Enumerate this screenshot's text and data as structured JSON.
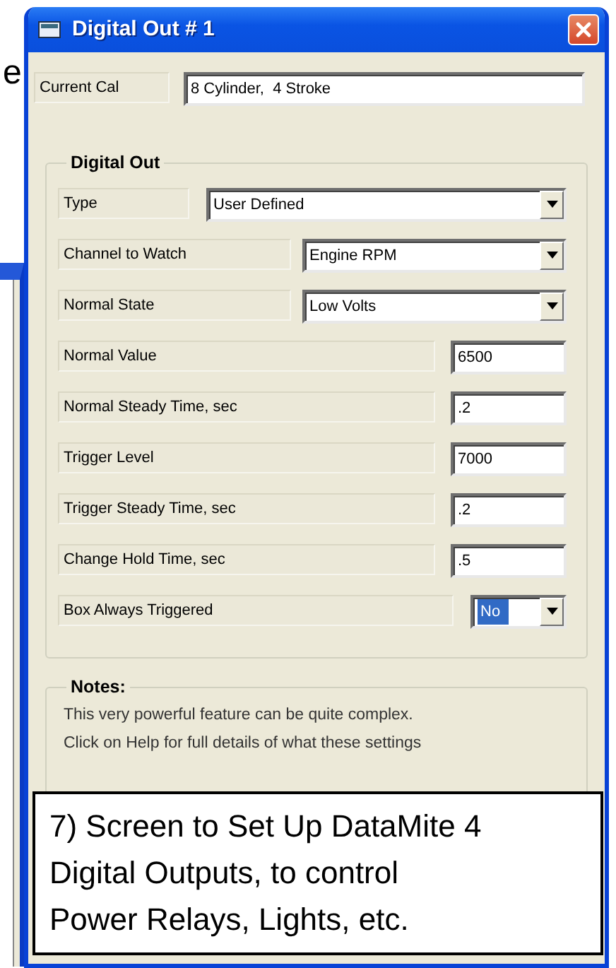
{
  "background_text": "e",
  "window": {
    "title": "Digital Out # 1"
  },
  "current_cal": {
    "label": "Current Cal",
    "value": "8 Cylinder,  4 Stroke"
  },
  "digital_out": {
    "title": "Digital Out",
    "fields": [
      {
        "kind": "combo-wide",
        "label": "Type",
        "value": "User Defined",
        "selected": false
      },
      {
        "kind": "combo",
        "label": "Channel to Watch",
        "value": "Engine RPM",
        "selected": false
      },
      {
        "kind": "combo",
        "label": "Normal State",
        "value": "Low Volts",
        "selected": false
      },
      {
        "kind": "text",
        "label": "Normal Value",
        "value": "6500"
      },
      {
        "kind": "text",
        "label": "Normal Steady Time, sec",
        "value": ".2"
      },
      {
        "kind": "text",
        "label": "Trigger Level",
        "value": "7000"
      },
      {
        "kind": "text",
        "label": "Trigger Steady Time, sec",
        "value": ".2"
      },
      {
        "kind": "text",
        "label": "Change Hold Time, sec",
        "value": ".5"
      },
      {
        "kind": "combo-short",
        "label": "Box Always Triggered",
        "value": "No",
        "selected": true
      }
    ]
  },
  "notes": {
    "title": "Notes:",
    "lines": [
      "This very powerful feature can be quite complex.",
      "Click on Help for full details of what these settings"
    ]
  },
  "caption": {
    "lines": [
      "7) Screen to Set Up DataMite 4",
      "Digital Outputs, to control",
      "Power Relays, Lights, etc."
    ]
  }
}
